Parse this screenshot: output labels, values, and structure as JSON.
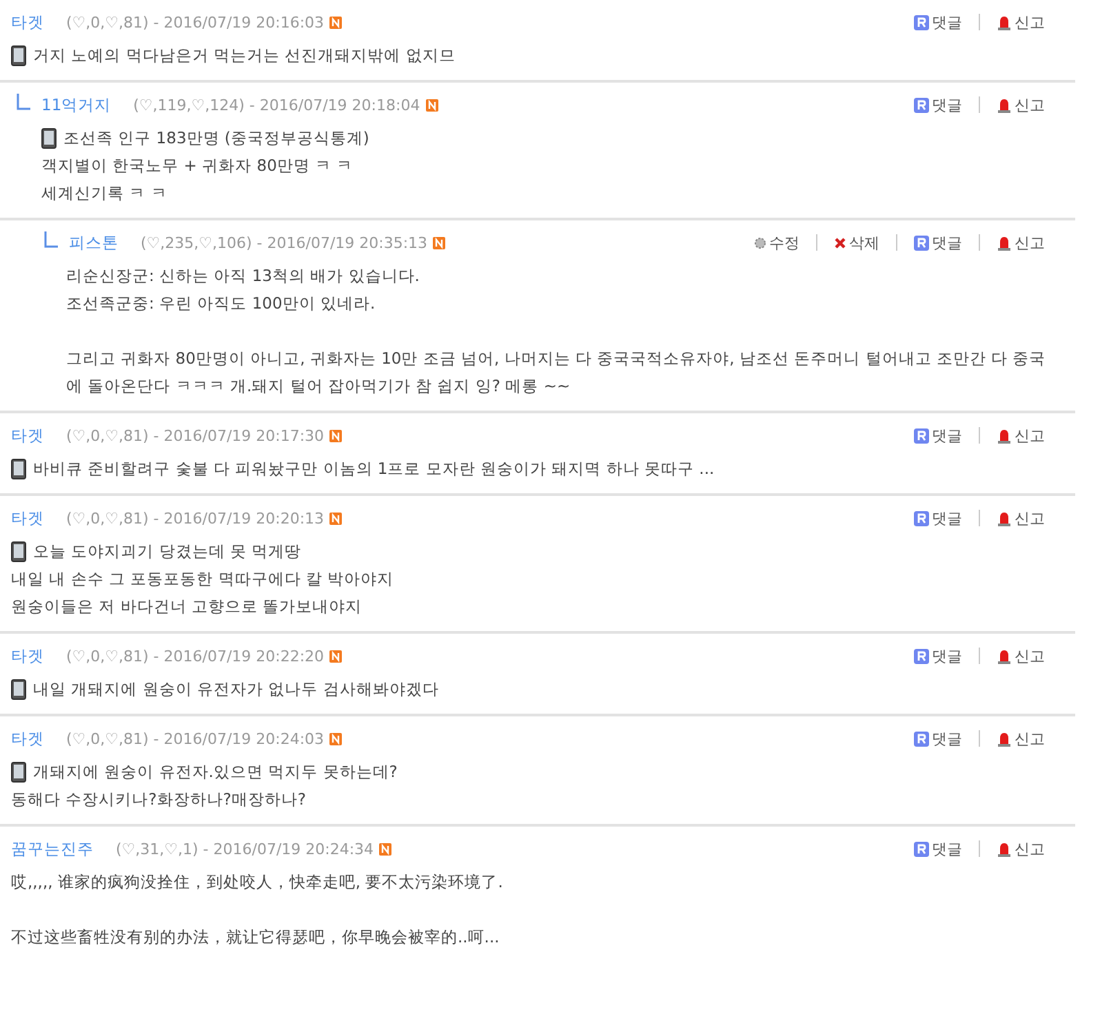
{
  "comments": [
    {
      "author": "타겟",
      "stats": "(♡,0,♡,81) -",
      "date": "2016/07/19 20:16:03",
      "new": true,
      "actions": [
        {
          "kind": "reply",
          "label": "댓글"
        },
        {
          "kind": "report",
          "label": "신고"
        }
      ],
      "mobile": true,
      "paragraphs": [
        [
          "거지 노예의 먹다남은거 먹는거는 선진개돼지밖에 없지므"
        ]
      ],
      "children": [
        {
          "author": "11억거지",
          "stats": "(♡,119,♡,124) -",
          "date": "2016/07/19 20:18:04",
          "new": true,
          "actions": [
            {
              "kind": "reply",
              "label": "댓글"
            },
            {
              "kind": "report",
              "label": "신고"
            }
          ],
          "mobile": true,
          "paragraphs": [
            [
              "조선족 인구 183만명 (중국정부공식통계)",
              "객지별이 한국노무 + 귀화자 80만명 ㅋ ㅋ",
              "세계신기록 ㅋ ㅋ"
            ]
          ],
          "children": [
            {
              "author": "피스톤",
              "stats": "(♡,235,♡,106) -",
              "date": "2016/07/19 20:35:13",
              "new": true,
              "actions": [
                {
                  "kind": "edit",
                  "label": "수정"
                },
                {
                  "kind": "delete",
                  "label": "삭제"
                },
                {
                  "kind": "reply",
                  "label": "댓글"
                },
                {
                  "kind": "report",
                  "label": "신고"
                }
              ],
              "mobile": false,
              "paragraphs": [
                [
                  "리순신장군: 신하는 아직 13척의 배가 있습니다.",
                  "조선족군중: 우린 아직도 100만이 있네라."
                ],
                [
                  "그리고 귀화자 80만명이 아니고, 귀화자는 10만 조금 넘어, 나머지는 다 중국국적소유자야, 남조선 돈주머니 털어내고 조만간 다 중국",
                  "에 돌아온단다 ㅋㅋㅋ 개.돼지 털어 잡아먹기가 참 쉽지 잉? 메롱 ~~"
                ]
              ]
            }
          ]
        }
      ]
    },
    {
      "author": "타겟",
      "stats": "(♡,0,♡,81) -",
      "date": "2016/07/19 20:17:30",
      "new": true,
      "actions": [
        {
          "kind": "reply",
          "label": "댓글"
        },
        {
          "kind": "report",
          "label": "신고"
        }
      ],
      "mobile": true,
      "paragraphs": [
        [
          "바비큐 준비할려구 숯불 다 피워놨구만 이놈의 1프로 모자란 원숭이가 돼지멱 하나 못따구 ..."
        ]
      ]
    },
    {
      "author": "타겟",
      "stats": "(♡,0,♡,81) -",
      "date": "2016/07/19 20:20:13",
      "new": true,
      "actions": [
        {
          "kind": "reply",
          "label": "댓글"
        },
        {
          "kind": "report",
          "label": "신고"
        }
      ],
      "mobile": true,
      "paragraphs": [
        [
          "오늘 도야지괴기 당겼는데 못 먹게땅",
          "내일 내 손수 그 포동포동한 멱따구에다 칼 박아야지",
          "원숭이들은 저 바다건너 고향으로 똘가보내야지"
        ]
      ]
    },
    {
      "author": "타겟",
      "stats": "(♡,0,♡,81) -",
      "date": "2016/07/19 20:22:20",
      "new": true,
      "actions": [
        {
          "kind": "reply",
          "label": "댓글"
        },
        {
          "kind": "report",
          "label": "신고"
        }
      ],
      "mobile": true,
      "paragraphs": [
        [
          "내일 개돼지에 원숭이 유전자가 없나두 검사해봐야겠다"
        ]
      ]
    },
    {
      "author": "타겟",
      "stats": "(♡,0,♡,81) -",
      "date": "2016/07/19 20:24:03",
      "new": true,
      "actions": [
        {
          "kind": "reply",
          "label": "댓글"
        },
        {
          "kind": "report",
          "label": "신고"
        }
      ],
      "mobile": true,
      "paragraphs": [
        [
          "개돼지에 원숭이 유전자.있으면 먹지두 못하는데?",
          "동해다 수장시키나?화장하나?매장하나?"
        ]
      ]
    },
    {
      "author": "꿈꾸는진주",
      "stats": "(♡,31,♡,1) -",
      "date": "2016/07/19 20:24:34",
      "new": true,
      "actions": [
        {
          "kind": "reply",
          "label": "댓글"
        },
        {
          "kind": "report",
          "label": "신고"
        }
      ],
      "mobile": false,
      "paragraphs": [
        [
          "哎,,,,, 谁家的疯狗没拴住，到处咬人，快牵走吧, 要不太污染环境了."
        ],
        [
          "不过这些畜牲没有别的办法，就让它得瑟吧，你早晚会被宰的..呵..."
        ]
      ]
    }
  ]
}
